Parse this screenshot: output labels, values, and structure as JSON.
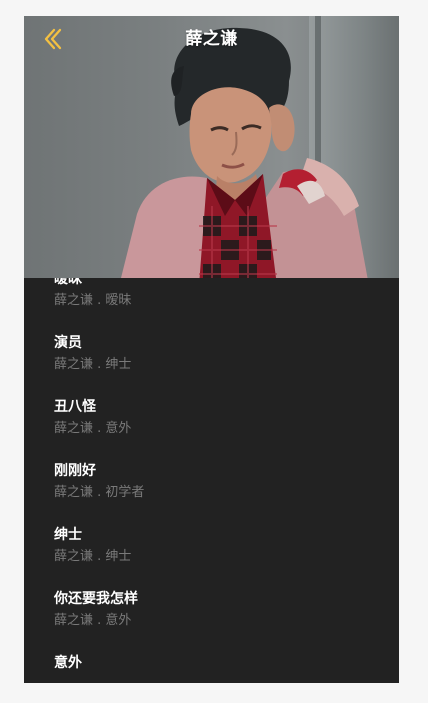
{
  "header": {
    "title": "薛之谦",
    "back_icon": "chevron-left-icon",
    "accent_color": "#f4c142"
  },
  "songs": [
    {
      "name": "暧昧",
      "subtitle": "薛之谦 . 暧昧"
    },
    {
      "name": "演员",
      "subtitle": "薛之谦 . 绅士"
    },
    {
      "name": "丑八怪",
      "subtitle": "薛之谦 . 意外"
    },
    {
      "name": "刚刚好",
      "subtitle": "薛之谦 . 初学者"
    },
    {
      "name": "绅士",
      "subtitle": "薛之谦 . 绅士"
    },
    {
      "name": "你还要我怎样",
      "subtitle": "薛之谦 . 意外"
    },
    {
      "name": "意外",
      "subtitle": ""
    }
  ]
}
